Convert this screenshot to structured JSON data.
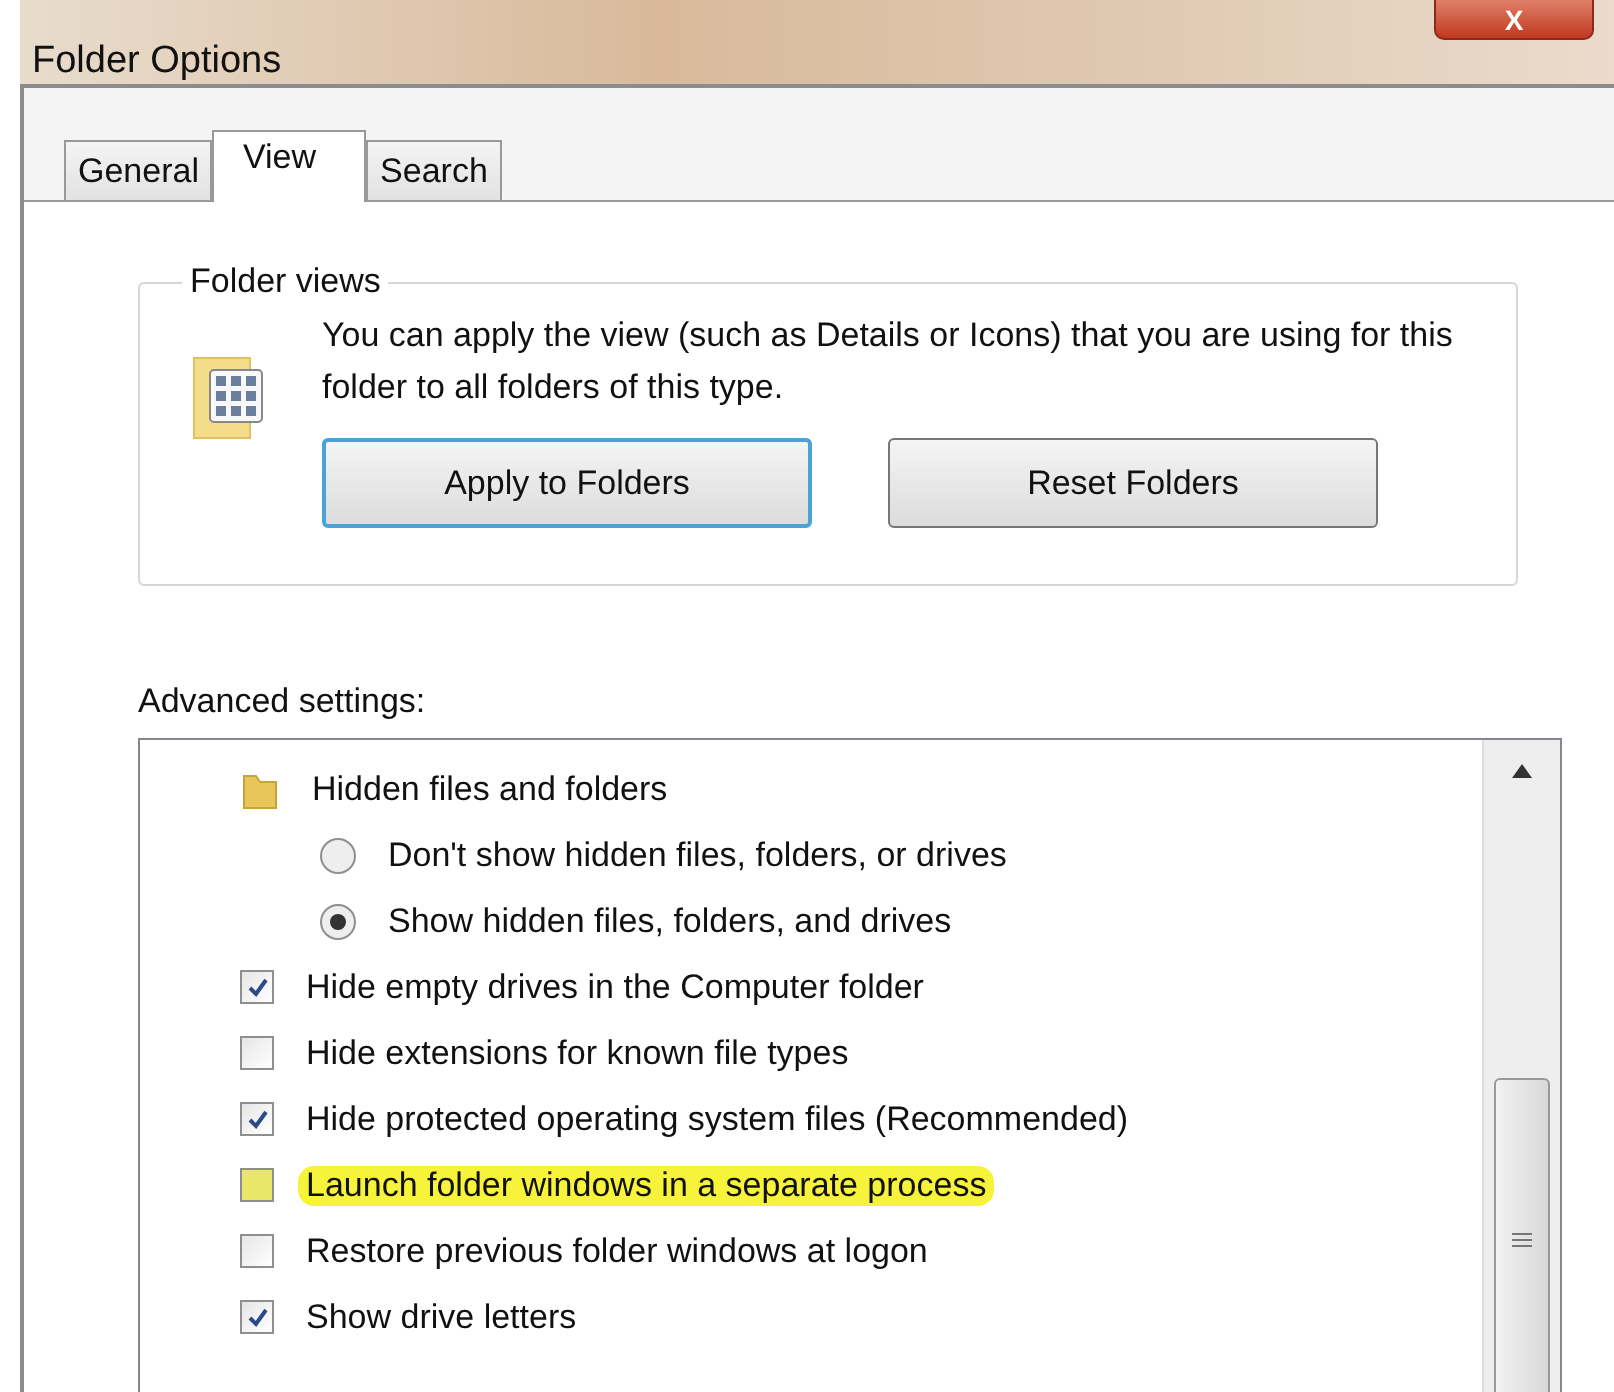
{
  "window": {
    "title": "Folder Options",
    "close_label": "X"
  },
  "tabs": [
    {
      "label": "General",
      "selected": false
    },
    {
      "label": "View",
      "selected": true
    },
    {
      "label": "Search",
      "selected": false
    }
  ],
  "folder_views": {
    "legend": "Folder views",
    "description": "You can apply the view (such as Details or Icons) that you are using for this folder to all folders of this type.",
    "buttons": [
      {
        "label": "Apply to Folders",
        "focused": true
      },
      {
        "label": "Reset Folders",
        "focused": false
      }
    ]
  },
  "advanced": {
    "label": "Advanced settings:",
    "items": [
      {
        "kind": "folder",
        "label": "Hidden files and folders",
        "highlighted": false
      },
      {
        "kind": "radio",
        "label": "Don't show hidden files, folders, or drives",
        "selected": false,
        "highlighted": false
      },
      {
        "kind": "radio",
        "label": "Show hidden files, folders, and drives",
        "selected": true,
        "highlighted": false
      },
      {
        "kind": "checkbox",
        "label": "Hide empty drives in the Computer folder",
        "checked": true,
        "highlighted": false
      },
      {
        "kind": "checkbox",
        "label": "Hide extensions for known file types",
        "checked": false,
        "highlighted": false
      },
      {
        "kind": "checkbox",
        "label": "Hide protected operating system files (Recommended)",
        "checked": true,
        "highlighted": false
      },
      {
        "kind": "checkbox",
        "label": "Launch folder windows in a separate process",
        "checked": false,
        "highlighted": true
      },
      {
        "kind": "checkbox",
        "label": "Restore previous folder windows at logon",
        "checked": false,
        "highlighted": false
      },
      {
        "kind": "checkbox",
        "label": "Show drive letters",
        "checked": true,
        "highlighted": false
      }
    ]
  }
}
